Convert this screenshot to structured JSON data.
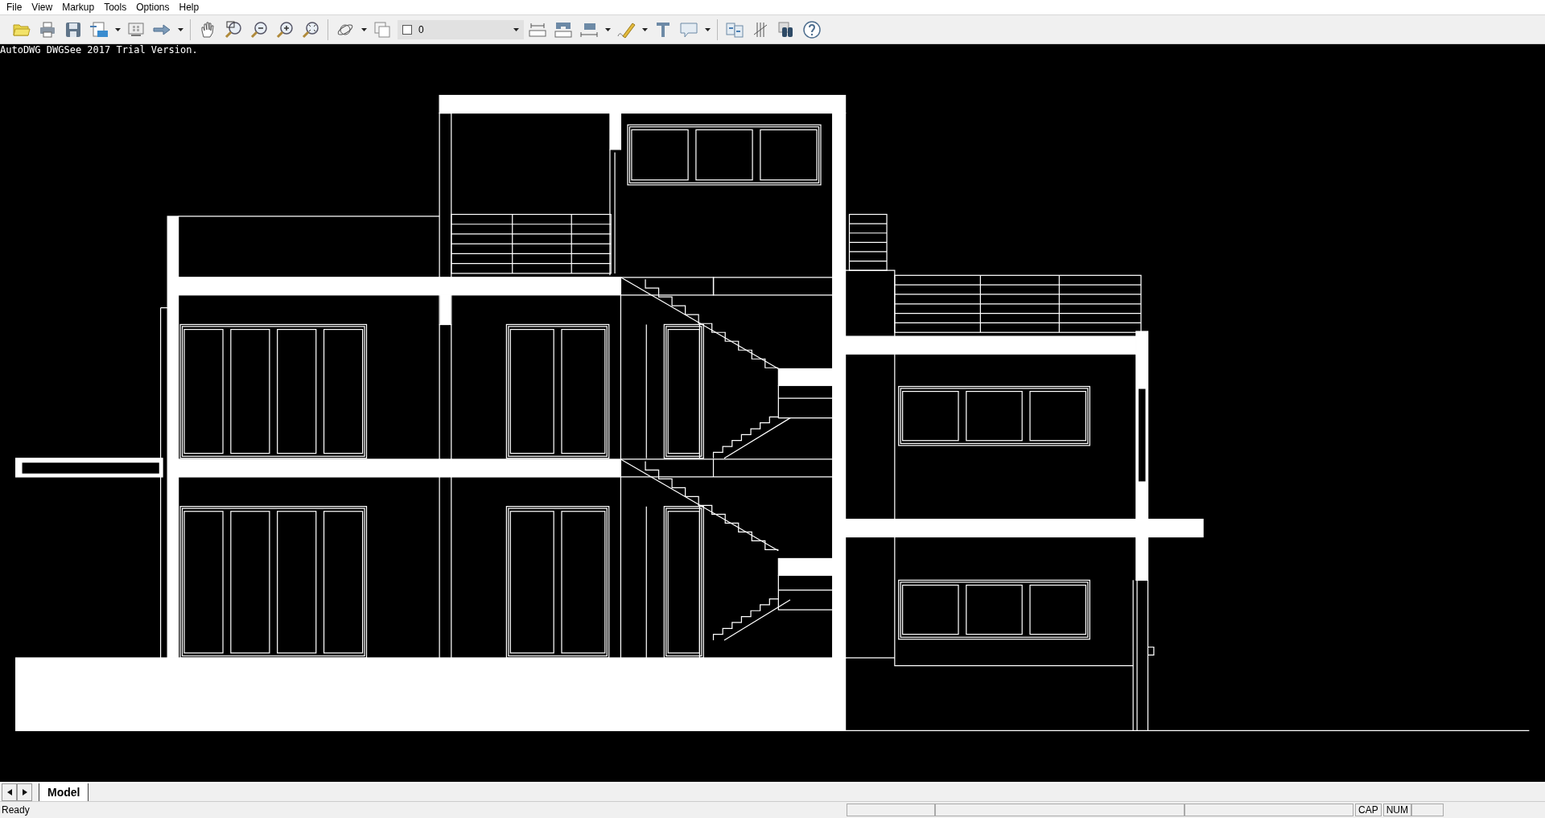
{
  "menu": [
    "File",
    "View",
    "Markup",
    "Tools",
    "Options",
    "Help"
  ],
  "toolbar": {
    "layer_combo": {
      "value": "0"
    }
  },
  "canvas": {
    "watermark": "AutoDWG DWGSee 2017 Trial Version."
  },
  "tabs": [
    {
      "label": "Model",
      "selected": true
    }
  ],
  "status_bar": {
    "text": "Ready",
    "indicators": [
      "CAP",
      "NUM"
    ]
  }
}
